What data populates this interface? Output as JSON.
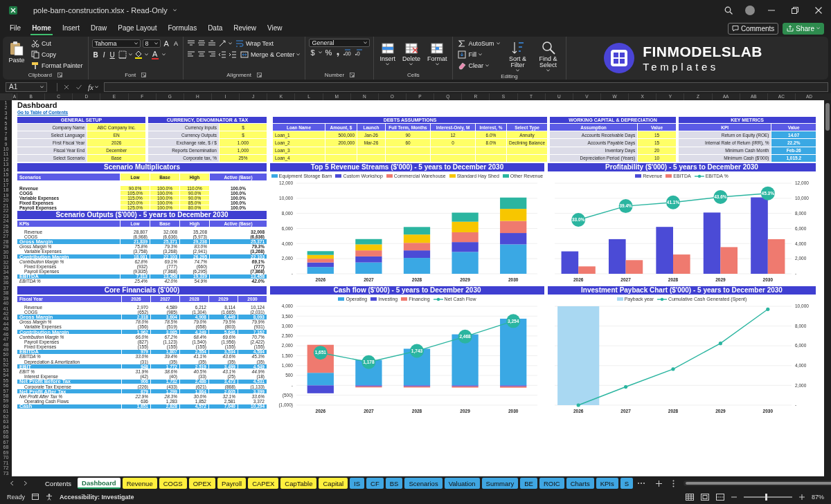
{
  "titlebar": {
    "title": "pole-barn-construction.xlsx - Read-Only"
  },
  "menubar": {
    "tabs": [
      {
        "label": "File",
        "selected": false
      },
      {
        "label": "Home",
        "selected": true
      },
      {
        "label": "Insert",
        "selected": false
      },
      {
        "label": "Draw",
        "selected": false
      },
      {
        "label": "Page Layout",
        "selected": false
      },
      {
        "label": "Formulas",
        "selected": false
      },
      {
        "label": "Data",
        "selected": false
      },
      {
        "label": "Review",
        "selected": false
      },
      {
        "label": "View",
        "selected": false
      }
    ],
    "buttons": [
      {
        "kind": "outline",
        "label": "Comments"
      },
      {
        "kind": "primary",
        "label": "Share"
      }
    ]
  },
  "ribbon": {
    "groups": [
      {
        "kind": "clipboard",
        "label": "Clipboard",
        "buttons": [
          "Paste",
          "Cut",
          "Copy",
          "Format Painter"
        ]
      },
      {
        "kind": "font",
        "label": "Font",
        "font": "Tahoma",
        "size": "8",
        "size_glyphs": [
          "A",
          "A"
        ],
        "styles": [
          "B",
          "I",
          "U"
        ],
        "color_glyph": "A"
      },
      {
        "kind": "alignment",
        "label": "Alignment",
        "buttons": [
          "Wrap Text",
          "Merge & Center"
        ]
      },
      {
        "kind": "number",
        "label": "Number",
        "format": "General",
        "glyphs": [
          "$",
          "%"
        ]
      },
      {
        "kind": "cells",
        "label": "Cells",
        "buttons": [
          "Insert",
          "Delete",
          "Format"
        ]
      },
      {
        "kind": "editing",
        "label": "Editing",
        "buttons": [
          "AutoSum",
          "Fill",
          "Clear",
          "Sort & Filter",
          "Find & Select"
        ]
      }
    ],
    "brand": {
      "name": "FINMODELSLAB",
      "tagline": "Templates"
    }
  },
  "formula_bar": {
    "cell": "A1",
    "function_label": "fx"
  },
  "sheet": {
    "title": "Dashboard",
    "link": "Go to Table of Contents",
    "column_letters": [
      "A",
      "B",
      "C",
      "D",
      "E",
      "F",
      "G",
      "H",
      "I",
      "J",
      "K",
      "L",
      "M",
      "N",
      "O",
      "P",
      "Q",
      "R",
      "S",
      "T",
      "U",
      "V",
      "W",
      "X",
      "Y",
      "Z",
      "AA",
      "AB",
      "AC",
      "AD"
    ],
    "row_numbers": [
      "1",
      "2",
      "3",
      "4",
      "5",
      "6",
      "7",
      "8",
      "9",
      "10",
      "11",
      "12",
      "13",
      "14",
      "15",
      "16",
      "17",
      "18",
      "19",
      "20",
      "21",
      "22",
      "23",
      "24",
      "25",
      "26",
      "27",
      "28",
      "29",
      "30",
      "31",
      "32",
      "33",
      "34",
      "35",
      "36",
      "37",
      "38",
      "39",
      "40",
      "41",
      "42",
      "43",
      "44",
      "45",
      "46",
      "47",
      "48",
      "49",
      "50",
      "51",
      "52",
      "53",
      "54",
      "55",
      "56",
      "57",
      "58",
      "59",
      "60",
      "61",
      "62",
      "63",
      "64",
      "65",
      "66",
      "67",
      "68",
      "69",
      "70",
      "71",
      "72",
      "73"
    ],
    "general_setup": {
      "kind": "form",
      "title": "GENERAL SETUP",
      "rows": [
        {
          "label": "Company Name",
          "value": "ABC Company Inc."
        },
        {
          "label": "Select Language",
          "value": "EN"
        },
        {
          "label": "First Fiscal Year",
          "value": "2026"
        },
        {
          "label": "Fiscal Year End",
          "value": "December"
        },
        {
          "label": "Select Scenario",
          "value": "Base"
        }
      ]
    },
    "currency": {
      "kind": "form",
      "title": "CURRENCY, DENOMINATOR & TAX",
      "rows": [
        {
          "label": "Currency Inputs",
          "value": "$"
        },
        {
          "label": "Currency Outputs",
          "value": "$"
        },
        {
          "label": "Exchange rate, $ / $",
          "value": "1.000"
        },
        {
          "label": "Reports Denomination",
          "value": "1,000"
        },
        {
          "label": "Corporate tax, %",
          "value": "25%"
        }
      ]
    },
    "debts": {
      "kind": "debts",
      "title": "DEBTS ASSUMPTIONS",
      "columns": [
        "Loan Name",
        "Amount, $",
        "Launch",
        "Full Term, Months",
        "Interest-Only, M",
        "Interest, %",
        "Select Type"
      ],
      "rows": [
        {
          "name": "Loan_1",
          "amount": "500,000",
          "launch": "Jan-26",
          "term": "90",
          "interest_only": "12",
          "rate": "6.0%",
          "type": "Annuity"
        },
        {
          "name": "Loan_2",
          "amount": "200,000",
          "launch": "Mar-26",
          "term": "60",
          "interest_only": "0",
          "rate": "8.0%",
          "type": "Declining Balance"
        },
        {
          "name": "Loan_3"
        },
        {
          "name": "Loan_4"
        }
      ]
    },
    "working_capital": {
      "kind": "form",
      "title": "WORKING CAPITAL & DEPRECIATION",
      "columns": [
        "Assumption",
        "Value"
      ],
      "rows": [
        {
          "label": "Accounts Receivable Days",
          "value": "15"
        },
        {
          "label": "Accounts Payable Days",
          "value": "15"
        },
        {
          "label": "Inventory Days",
          "value": "20"
        },
        {
          "label": "Depreciation Period (Years)",
          "value": "10"
        }
      ]
    },
    "key_metrics": {
      "kind": "metrics",
      "title": "KEY METRICS",
      "columns": [
        "KPI",
        "Value"
      ],
      "rows": [
        {
          "label": "Return on Equity (ROE)",
          "value": "14.07"
        },
        {
          "label": "Internal Rate of Return (IRR), %",
          "value": "22.2%"
        },
        {
          "label": "Minimum Cash Month",
          "value": "Feb-26"
        },
        {
          "label": "Minimum Cash ($'000)",
          "value": "1,015.2"
        }
      ]
    },
    "multipliers": {
      "kind": "multipliers",
      "title": "Scenario Multiplicators",
      "columns": [
        "Scenarios",
        "Low",
        "Base",
        "High",
        "Active (Base)"
      ],
      "rows": [
        {
          "label": "Revenue",
          "values": [
            "90.0%",
            "100.0%",
            "110.0%",
            "100.0%"
          ]
        },
        {
          "label": "COGS",
          "values": [
            "105.0%",
            "100.0%",
            "90.0%",
            "100.0%"
          ]
        },
        {
          "label": "Variable Expenses",
          "values": [
            "115.0%",
            "100.0%",
            "90.0%",
            "100.0%"
          ]
        },
        {
          "label": "Fixed Expenses",
          "values": [
            "120.0%",
            "100.0%",
            "85.0%",
            "100.0%"
          ]
        },
        {
          "label": "Payroll Expenses",
          "values": [
            "125.0%",
            "100.0%",
            "80.0%",
            "100.0%"
          ]
        }
      ]
    },
    "scenario_outputs": {
      "kind": "scenario",
      "title": "Scenario Outputs ($'000) - 5 years to December 2030",
      "columns": [
        "KPIs",
        "Low",
        "Base",
        "High",
        "Active (Base)"
      ],
      "rows": [
        {
          "kind": "item",
          "label": "Revenue",
          "values": [
            "28,807",
            "32,008",
            "35,208",
            "32,008"
          ]
        },
        {
          "kind": "item",
          "label": "COGS",
          "values": [
            "(6,968)",
            "(6,636)",
            "(5,973)",
            "(6,636)"
          ]
        },
        {
          "kind": "band",
          "label": "Gross Margin",
          "values": [
            "21,839",
            "25,371",
            "29,236",
            "25,371"
          ]
        },
        {
          "kind": "pct",
          "label": "Gross Margin %",
          "values": [
            "75.8%",
            "79.3%",
            "83.0%",
            "79.3%"
          ]
        },
        {
          "kind": "item",
          "label": "Variable Expenses",
          "values": [
            "(3,758)",
            "(3,268)",
            "(2,941)",
            "(3,268)"
          ]
        },
        {
          "kind": "band",
          "label": "Contribution Margin",
          "values": [
            "18,081",
            "22,103",
            "26,295",
            "22,103"
          ]
        },
        {
          "kind": "pct",
          "label": "Contribution Margin %",
          "values": [
            "62.8%",
            "69.1%",
            "74.7%",
            "69.1%"
          ]
        },
        {
          "kind": "item",
          "label": "Fixed Expenses",
          "values": [
            "(932)",
            "(777)",
            "(660)",
            "(777)"
          ]
        },
        {
          "kind": "item",
          "label": "Payroll Expenses",
          "values": [
            "(9,835)",
            "(7,868)",
            "(6,295)",
            "(7,868)"
          ]
        },
        {
          "kind": "band",
          "label": "EBITDA",
          "values": [
            "7,313",
            "13,458",
            "19,339",
            "13,458"
          ]
        },
        {
          "kind": "pct",
          "label": "EBITDA %",
          "values": [
            "25.4%",
            "42.0%",
            "54.9%",
            "42.0%"
          ]
        }
      ]
    },
    "core_financials": {
      "kind": "scenario",
      "title": "Core Financials ($'000)",
      "columns": [
        "Fiscal Year",
        "2026",
        "2027",
        "2028",
        "2029",
        "2030"
      ],
      "rows": [
        {
          "kind": "item",
          "label": "Revenue",
          "values": [
            "2,970",
            "4,589",
            "6,212",
            "8,114",
            "10,124"
          ]
        },
        {
          "kind": "item",
          "label": "COGS",
          "values": [
            "(652)",
            "(985)",
            "(1,304)",
            "(1,665)",
            "(2,031)"
          ]
        },
        {
          "kind": "band",
          "label": "Gross Margin",
          "values": [
            "2,318",
            "3,604",
            "4,908",
            "6,449",
            "8,093"
          ]
        },
        {
          "kind": "pct",
          "label": "Gross Margin %",
          "values": [
            "78.0%",
            "78.5%",
            "79.0%",
            "79.5%",
            "79.9%"
          ]
        },
        {
          "kind": "item",
          "label": "Variable Expenses",
          "values": [
            "(356)",
            "(519)",
            "(658)",
            "(803)",
            "(931)"
          ]
        },
        {
          "kind": "band",
          "label": "Contribution Margin",
          "values": [
            "1,962",
            "3,085",
            "4,249",
            "5,646",
            "7,162"
          ]
        },
        {
          "kind": "pct",
          "label": "Contribution Margin %",
          "values": [
            "66.0%",
            "67.2%",
            "68.4%",
            "69.6%",
            "70.7%"
          ]
        },
        {
          "kind": "item",
          "label": "Payroll Expenses",
          "values": [
            "(827)",
            "(1,123)",
            "(1,540)",
            "(1,956)",
            "(2,422)"
          ]
        },
        {
          "kind": "item",
          "label": "Fixed Expenses",
          "values": [
            "(155)",
            "(155)",
            "(155)",
            "(155)",
            "(155)"
          ]
        },
        {
          "kind": "band",
          "label": "EBITDA",
          "values": [
            "979",
            "1,807",
            "2,554",
            "3,534",
            "4,584"
          ]
        },
        {
          "kind": "pct",
          "label": "EBITDA %",
          "values": [
            "33.0%",
            "39.4%",
            "41.1%",
            "43.6%",
            "45.3%"
          ]
        },
        {
          "kind": "item",
          "label": "Depreciation & Amortization",
          "values": [
            "(31)",
            "(35)",
            "(35)",
            "(35)",
            "(35)"
          ]
        },
        {
          "kind": "band",
          "label": "EBIT",
          "values": [
            "948",
            "1,772",
            "2,519",
            "3,499",
            "4,549"
          ]
        },
        {
          "kind": "pct",
          "label": "EBIT %",
          "values": [
            "31.9%",
            "38.6%",
            "40.5%",
            "43.1%",
            "44.9%"
          ]
        },
        {
          "kind": "item",
          "label": "Interest Expense",
          "values": [
            "(42)",
            "(40)",
            "(33)",
            "(25)",
            "(18)"
          ]
        },
        {
          "kind": "band",
          "label": "Net Profit Before Tax",
          "values": [
            "906",
            "1,732",
            "2,486",
            "3,473",
            "4,531"
          ]
        },
        {
          "kind": "item",
          "label": "Corporate Tax Expense",
          "values": [
            "(226)",
            "(433)",
            "(621)",
            "(868)",
            "(1,133)"
          ]
        },
        {
          "kind": "band",
          "label": "Net Profit After Tax",
          "values": [
            "679",
            "1,299",
            "1,864",
            "2,605",
            "3,399"
          ]
        },
        {
          "kind": "pct",
          "label": "Net Profit After Tax %",
          "values": [
            "22.9%",
            "28.3%",
            "30.0%",
            "32.1%",
            "33.6%"
          ]
        },
        {
          "kind": "item",
          "label": "Operating Cash Flows",
          "values": [
            "636",
            "1,283",
            "1,852",
            "2,581",
            "3,372"
          ]
        },
        {
          "kind": "band",
          "label": "Cash",
          "values": [
            "1,651",
            "2,828",
            "4,572",
            "7,040",
            "10,294"
          ]
        }
      ]
    },
    "charts": [
      {
        "chart_data": {
          "type": "bar",
          "grid": true,
          "title": "Top 5 Revenue Streams ($'000) - 5 years to December 2030",
          "categories": [
            "2026",
            "2027",
            "2028",
            "2029",
            "2030"
          ],
          "stacked": true,
          "ylim": [
            0,
            12000
          ],
          "yticks": [
            {
              "value": 0,
              "label": "-"
            },
            {
              "value": 2000,
              "label": "2,000"
            },
            {
              "value": 4000,
              "label": "4,000"
            },
            {
              "value": 6000,
              "label": "6,000"
            },
            {
              "value": 8000,
              "label": "8,000"
            },
            {
              "value": 10000,
              "label": "10,000"
            },
            {
              "value": 12000,
              "label": "12,000"
            }
          ],
          "series": [
            {
              "name": "Equipment Storage Barn",
              "color": "#3aa8e4",
              "values": [
                900,
                1500,
                2100,
                2900,
                3900
              ]
            },
            {
              "name": "Custom Workshop",
              "color": "#4b4bd6",
              "values": [
                600,
                800,
                1000,
                1300,
                1500
              ]
            },
            {
              "name": "Commercial Warehouse",
              "color": "#ef7a6f",
              "values": [
                500,
                800,
                1000,
                1300,
                1600
              ]
            },
            {
              "name": "Standard Hay Shed",
              "color": "#f7c600",
              "values": [
                500,
                800,
                1100,
                1400,
                1600
              ]
            },
            {
              "name": "Other Revenue",
              "color": "#2bb5a0",
              "values": [
                500,
                700,
                1000,
                1200,
                1500
              ]
            }
          ]
        }
      },
      {
        "chart_data": {
          "type": "bar",
          "grid": true,
          "title": "Profitability ($'000) - 5 years to December 2030",
          "categories": [
            "2026",
            "2027",
            "2028",
            "2029",
            "2030"
          ],
          "stacked": false,
          "ylim": [
            0,
            12000
          ],
          "y2lim": [
            8,
            50
          ],
          "yticks": [
            {
              "value": 0,
              "label": "-"
            },
            {
              "value": 2000,
              "label": "2,000"
            },
            {
              "value": 4000,
              "label": "4,000"
            },
            {
              "value": 6000,
              "label": "6,000"
            },
            {
              "value": 8000,
              "label": "8,000"
            },
            {
              "value": 10000,
              "label": "10,000"
            },
            {
              "value": 12000,
              "label": "12,000"
            }
          ],
          "series": [
            {
              "name": "Revenue",
              "color": "#4b4bd6",
              "values": [
                2970,
                4589,
                6212,
                8114,
                10124
              ]
            },
            {
              "name": "EBITDA",
              "color": "#ef7a6f",
              "values": [
                979,
                1807,
                2554,
                3534,
                4584
              ]
            },
            {
              "name": "EBITDA %",
              "color": "#2bb5a0",
              "type": "line",
              "axis": "y2",
              "marker": true,
              "values": [
                33.0,
                39.4,
                41.1,
                43.6,
                45.3
              ],
              "value_labels": [
                "33.0%",
                "39.4%",
                "41.1%",
                "43.6%",
                "45.3%"
              ]
            }
          ]
        }
      },
      {
        "chart_data": {
          "type": "bar",
          "grid": true,
          "title": "Cash flow ($'000) - 5 years to December 2030",
          "categories": [
            "2026",
            "2027",
            "2028",
            "2029",
            "2030"
          ],
          "stacked": true,
          "ylim": [
            -1000,
            4000
          ],
          "yticks": [
            {
              "value": -1000,
              "label": "(1,000)"
            },
            {
              "value": -500,
              "label": "(500)"
            },
            {
              "value": 0,
              "label": "-"
            },
            {
              "value": 500,
              "label": "500"
            },
            {
              "value": 1000,
              "label": "1,000"
            },
            {
              "value": 1500,
              "label": "1,500"
            },
            {
              "value": 2000,
              "label": "2,000"
            },
            {
              "value": 2500,
              "label": "2,500"
            },
            {
              "value": 3000,
              "label": "3,000"
            },
            {
              "value": 3500,
              "label": "3,500"
            },
            {
              "value": 4000,
              "label": "4,000"
            }
          ],
          "series": [
            {
              "name": "Operating",
              "color": "#3aa8e4",
              "values": [
                636,
                1283,
                1852,
                2581,
                3372
              ]
            },
            {
              "name": "Investing",
              "color": "#4b4bd6",
              "values": [
                -400,
                -50,
                -50,
                -50,
                -50
              ]
            },
            {
              "name": "Financing",
              "color": "#ef7a6f",
              "values": [
                1415,
                -55,
                -59,
                -63,
                -68
              ]
            },
            {
              "name": "Net Cash Flow",
              "color": "#2bb5a0",
              "type": "line",
              "marker": true,
              "values": [
                1651,
                1178,
                1743,
                2468,
                3254
              ],
              "value_labels": [
                "1,651",
                "1,178",
                "1,743",
                "2,468",
                "3,254"
              ]
            }
          ]
        }
      },
      {
        "chart_data": {
          "type": "bar",
          "grid": true,
          "title": "Investment Payback Chart ($'000) - 5 years to December 2030",
          "categories": [
            "2026",
            "2027",
            "2028",
            "2029",
            "2030"
          ],
          "stacked": false,
          "ylim": [
            0,
            10000
          ],
          "yticks": [
            {
              "value": 0,
              "label": "-"
            },
            {
              "value": 2000,
              "label": "2,000"
            },
            {
              "value": 4000,
              "label": "4,000"
            },
            {
              "value": 6000,
              "label": "6,000"
            },
            {
              "value": 8000,
              "label": "8,000"
            },
            {
              "value": 10000,
              "label": "10,000"
            }
          ],
          "series": [
            {
              "name": "Payback year",
              "color": "#a9d8f2",
              "values": [
                10000,
                null,
                null,
                null,
                null
              ]
            },
            {
              "name": "Cumulative Cash Generated (Spent)",
              "color": "#2bb5a0",
              "type": "line",
              "marker": true,
              "values": [
                0,
                1850,
                3650,
                6250,
                9700
              ]
            }
          ]
        }
      }
    ]
  },
  "sheet_tabs": [
    {
      "label": "Contents",
      "selected": false
    },
    {
      "label": "Dashboard",
      "selected": true
    },
    {
      "label": "Revenue",
      "selected": false,
      "color": "#ffef3d"
    },
    {
      "label": "COGS",
      "selected": false,
      "color": "#ffef3d"
    },
    {
      "label": "OPEX",
      "selected": false,
      "color": "#ffef3d"
    },
    {
      "label": "Payroll",
      "selected": false,
      "color": "#ffef3d"
    },
    {
      "label": "CAPEX",
      "selected": false,
      "color": "#ffef3d"
    },
    {
      "label": "CapTable",
      "selected": false,
      "color": "#ffef3d"
    },
    {
      "label": "Capital",
      "selected": false,
      "color": "#ffef3d"
    },
    {
      "label": "IS",
      "selected": false,
      "color": "#3fa6e2"
    },
    {
      "label": "CF",
      "selected": false,
      "color": "#3fa6e2"
    },
    {
      "label": "BS",
      "selected": false,
      "color": "#3fa6e2"
    },
    {
      "label": "Scenarios",
      "selected": false,
      "color": "#3fa6e2"
    },
    {
      "label": "Valuation",
      "selected": false,
      "color": "#3fa6e2"
    },
    {
      "label": "Summary",
      "selected": false,
      "color": "#3fa6e2"
    },
    {
      "label": "BE",
      "selected": false,
      "color": "#3fa6e2"
    },
    {
      "label": "ROIC",
      "selected": false,
      "color": "#3fa6e2"
    },
    {
      "label": "Charts",
      "selected": false,
      "color": "#3fa6e2"
    },
    {
      "label": "KPIs",
      "selected": false,
      "color": "#3fa6e2"
    },
    {
      "label": "S",
      "selected": false,
      "color": "#3fa6e2"
    }
  ],
  "status_bar": {
    "mode": "Ready",
    "accessibility": "Accessibility: Investigate",
    "zoom": {
      "level": 0.47,
      "label": "87%"
    }
  }
}
